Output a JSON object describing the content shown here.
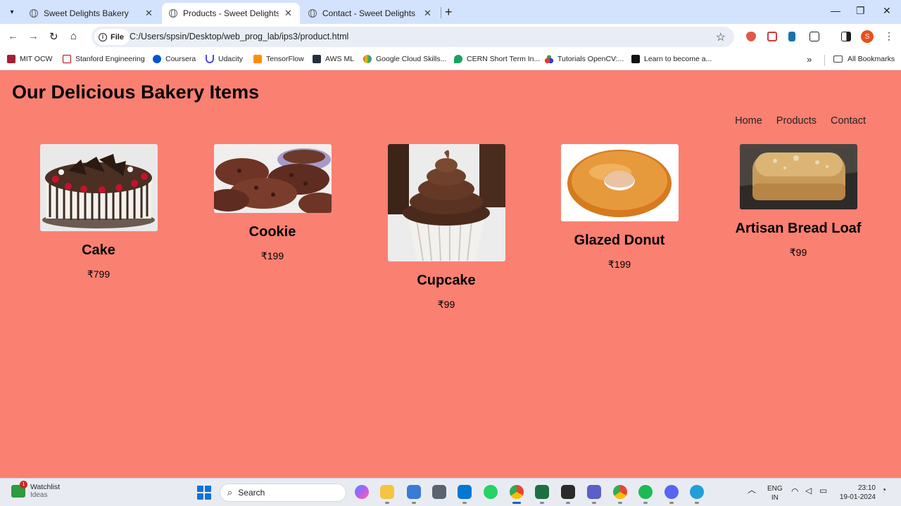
{
  "browser": {
    "tabs": [
      {
        "title": "Sweet Delights Bakery",
        "active": false
      },
      {
        "title": "Products - Sweet Delights Bakery",
        "active": true
      },
      {
        "title": "Contact - Sweet Delights Bakery",
        "active": false
      }
    ],
    "file_chip": "File",
    "url": "C:/Users/spsin/Desktop/web_prog_lab/ips3/product.html",
    "profile_initial": "S",
    "bookmarks": [
      "MIT OCW",
      "Stanford Engineering",
      "Coursera",
      "Udacity",
      "TensorFlow",
      "AWS ML",
      "Google Cloud Skills...",
      "CERN Short Term In...",
      "Tutorials OpenCV:...",
      "Learn to become a..."
    ],
    "all_bookmarks": "All Bookmarks"
  },
  "page": {
    "title": "Our Delicious Bakery Items",
    "nav": [
      "Home",
      "Products",
      "Contact"
    ],
    "products": [
      {
        "name": "Cake",
        "price": "₹799",
        "image": "cake"
      },
      {
        "name": "Cookie",
        "price": "₹199",
        "image": "cookie"
      },
      {
        "name": "Cupcake",
        "price": "₹99",
        "image": "cupcake"
      },
      {
        "name": "Glazed Donut",
        "price": "₹199",
        "image": "donut"
      },
      {
        "name": "Artisan Bread Loaf",
        "price": "₹99",
        "image": "bread"
      }
    ],
    "background_color": "#fa8072"
  },
  "taskbar": {
    "widget_title": "Watchlist",
    "widget_subtitle": "Ideas",
    "widget_badge": "1",
    "search_label": "Search",
    "lang_top": "ENG",
    "lang_bottom": "IN",
    "time": "23:10",
    "date": "19-01-2024"
  }
}
